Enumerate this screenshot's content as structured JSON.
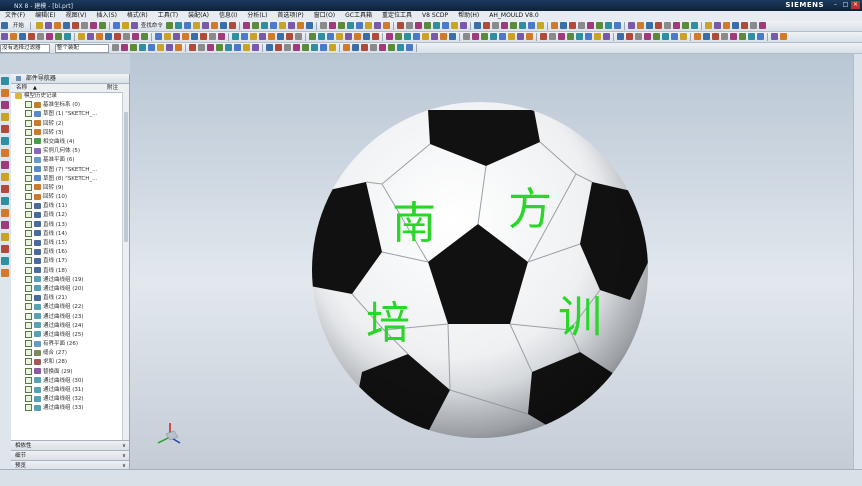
{
  "titlebar": {
    "text": "NX 8 - 建模 - [bl.prt]",
    "brand": "SIEMENS"
  },
  "menu": [
    "文件(F)",
    "编辑(E)",
    "视图(V)",
    "插入(S)",
    "格式(R)",
    "工具(T)",
    "装配(A)",
    "信息(I)",
    "分析(L)",
    "首选项(P)",
    "窗口(O)",
    "GC工具箱",
    "重定位工具",
    "V8 SCDP",
    "帮助(H)",
    "AH_MOULD V8.0"
  ],
  "toolbar1": {
    "start_label": "开始",
    "find_cmd_label": "查找命令",
    "combo": "命令查找器"
  },
  "toolbar3": {
    "filter_combo": "没有选择过滤器",
    "assembly_combo": "整个装配"
  },
  "navigator": {
    "title": "部件导航器",
    "col_name": "名称",
    "col_latest": "附注",
    "items": [
      {
        "label": "模型历史记录",
        "type": "folder"
      },
      {
        "label": "基准坐标系 (0)",
        "type": "csys"
      },
      {
        "label": "草图 (1) \"SKETCH_...",
        "type": "sketch"
      },
      {
        "label": "回转 (2)",
        "type": "revolve"
      },
      {
        "label": "回转 (3)",
        "type": "revolve"
      },
      {
        "label": "相交曲线 (4)",
        "type": "curve"
      },
      {
        "label": "实例几何体 (5)",
        "type": "geom"
      },
      {
        "label": "基准平面 (6)",
        "type": "plane"
      },
      {
        "label": "草图 (7) \"SKETCH_...",
        "type": "sketch"
      },
      {
        "label": "草图 (8) \"SKETCH_...",
        "type": "sketch"
      },
      {
        "label": "回转 (9)",
        "type": "revolve"
      },
      {
        "label": "回转 (10)",
        "type": "revolve"
      },
      {
        "label": "直线 (11)",
        "type": "line"
      },
      {
        "label": "直线 (12)",
        "type": "line"
      },
      {
        "label": "直线 (13)",
        "type": "line"
      },
      {
        "label": "直线 (14)",
        "type": "line"
      },
      {
        "label": "直线 (15)",
        "type": "line"
      },
      {
        "label": "直线 (16)",
        "type": "line"
      },
      {
        "label": "直线 (17)",
        "type": "line"
      },
      {
        "label": "直线 (18)",
        "type": "line"
      },
      {
        "label": "通过曲线组 (19)",
        "type": "surf"
      },
      {
        "label": "通过曲线组 (20)",
        "type": "surf"
      },
      {
        "label": "直线 (21)",
        "type": "line"
      },
      {
        "label": "通过曲线组 (22)",
        "type": "surf"
      },
      {
        "label": "通过曲线组 (23)",
        "type": "surf"
      },
      {
        "label": "通过曲线组 (24)",
        "type": "surf"
      },
      {
        "label": "通过曲线组 (25)",
        "type": "surf"
      },
      {
        "label": "有界平面 (26)",
        "type": "plane"
      },
      {
        "label": "缝合 (27)",
        "type": "sew"
      },
      {
        "label": "求和 (28)",
        "type": "unite"
      },
      {
        "label": "替换面 (29)",
        "type": "replace"
      },
      {
        "label": "通过曲线组 (30)",
        "type": "surf"
      },
      {
        "label": "通过曲线组 (31)",
        "type": "surf"
      },
      {
        "label": "通过曲线组 (32)",
        "type": "surf"
      },
      {
        "label": "通过曲线组 (33)",
        "type": "surf"
      }
    ],
    "panels": [
      "相依性",
      "细节",
      "预览"
    ]
  },
  "ball_text": {
    "c1": "南",
    "c2": "方",
    "c3": "培",
    "c4": "训",
    "color": "#2bd62b"
  },
  "colors": {
    "titlebar": "#0e2238",
    "viewport_top": "#b9c6d4",
    "viewport_mid": "#e2e8ee"
  }
}
